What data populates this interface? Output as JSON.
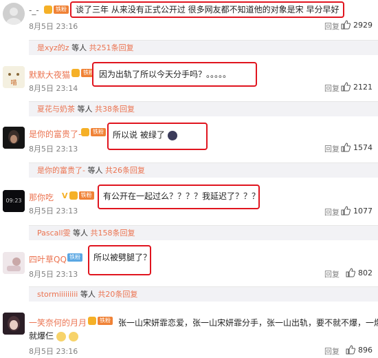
{
  "comments": [
    {
      "username": "-_-",
      "badge": "铁粉",
      "text": "谈了三年 从来没有正式公开过 很多网友都不知道他的对象是宋 早分早好",
      "date": "8月5日 23:16",
      "reply": "回复",
      "likes": "2929",
      "sub_user": "是xyz的z",
      "sub_mid": " 等人 ",
      "sub_count": "共251条回复"
    },
    {
      "username": "默默大夜猫",
      "badge": "铁粉",
      "text": "因为出轨了所以今天分手吗？。。。。。",
      "date": "8月5日 23:14",
      "reply": "回复",
      "likes": "2121",
      "sub_user": "夏花与奶茶",
      "sub_mid": " 等人 ",
      "sub_count": "共38条回复"
    },
    {
      "username": "是你的富贵了-",
      "badge": "铁粉",
      "text": "所以说  被绿了",
      "date": "8月5日 23:13",
      "reply": "回复",
      "likes": "1574",
      "sub_user": "是你的富贵了-",
      "sub_mid": " 等人 ",
      "sub_count": "共26条回复"
    },
    {
      "username": "那你吃",
      "badge": "铁粉",
      "text": "有公开在一起过么？？？？我延迟了？？？",
      "date": "8月5日 23:13",
      "reply": "回复",
      "likes": "1077",
      "sub_user": "Pascall雯",
      "sub_mid": " 等人 ",
      "sub_count": "共158条回复"
    },
    {
      "username": "四叶草QQ",
      "badge": "铁粉",
      "text": "所以被劈腿了？",
      "date": "8月5日 23:13",
      "reply": "回复",
      "likes": "802",
      "sub_user": "stormiiiiiiiii",
      "sub_mid": " 等人 ",
      "sub_count": "共20条回复"
    },
    {
      "username": "一笑奈何的月月",
      "badge": "铁粉",
      "text": "张一山宋妍霏恋爱，张一山宋妍霏分手，张一山出轨，要不就不爆，一爆",
      "text2": "就爆仨",
      "date": "8月5日 23:16",
      "reply": "回复",
      "likes": "896"
    }
  ],
  "colors": {
    "highlight_box": "#e0141e",
    "username": "#eb7350",
    "meta": "#808080"
  }
}
